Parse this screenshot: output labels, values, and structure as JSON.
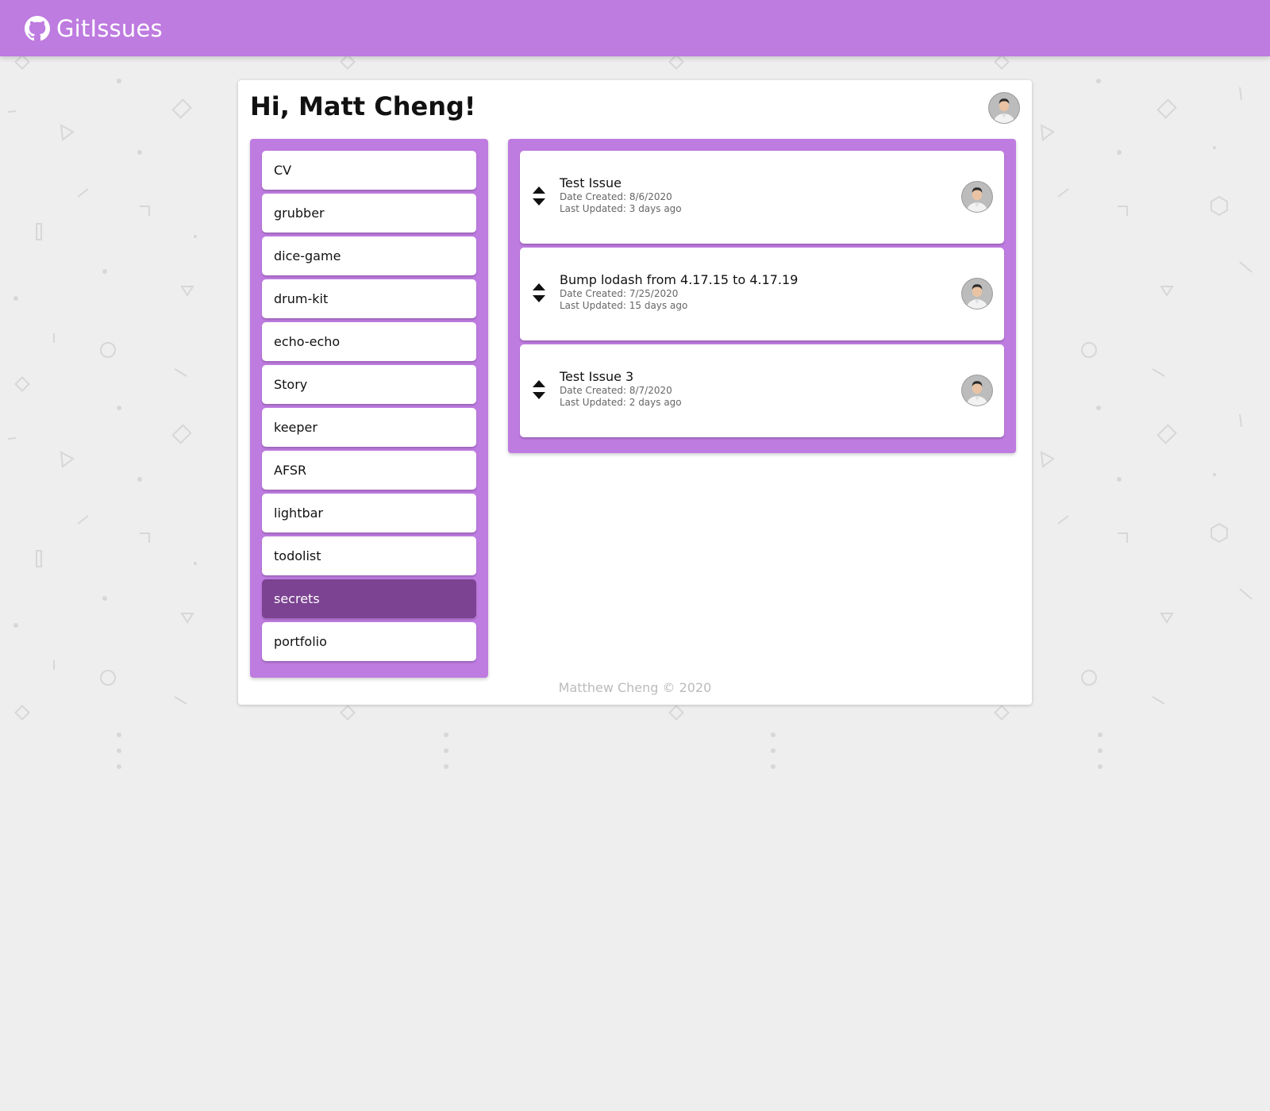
{
  "app": {
    "title": "GitIssues"
  },
  "header": {
    "greeting": "Hi, Matt Cheng!"
  },
  "repos": [
    {
      "name": "CV"
    },
    {
      "name": "grubber"
    },
    {
      "name": "dice-game"
    },
    {
      "name": "drum-kit"
    },
    {
      "name": "echo-echo"
    },
    {
      "name": "Story"
    },
    {
      "name": "keeper"
    },
    {
      "name": "AFSR"
    },
    {
      "name": "lightbar"
    },
    {
      "name": "todolist"
    },
    {
      "name": "secrets",
      "selected": true
    },
    {
      "name": "portfolio"
    }
  ],
  "issues": [
    {
      "title": "Test Issue",
      "created": "Date Created: 8/6/2020",
      "updated": "Last Updated: 3 days ago"
    },
    {
      "title": "Bump lodash from 4.17.15 to 4.17.19",
      "created": "Date Created: 7/25/2020",
      "updated": "Last Updated: 15 days ago"
    },
    {
      "title": "Test Issue 3",
      "created": "Date Created: 8/7/2020",
      "updated": "Last Updated: 2 days ago"
    }
  ],
  "footer": {
    "text": "Matthew Cheng © 2020"
  },
  "icons": {
    "brand": "github-icon",
    "sort": "sort-icon",
    "avatar": "user-avatar"
  },
  "colors": {
    "accent": "#be7be0",
    "selected": "#7b4391",
    "background": "#eeeeee"
  }
}
